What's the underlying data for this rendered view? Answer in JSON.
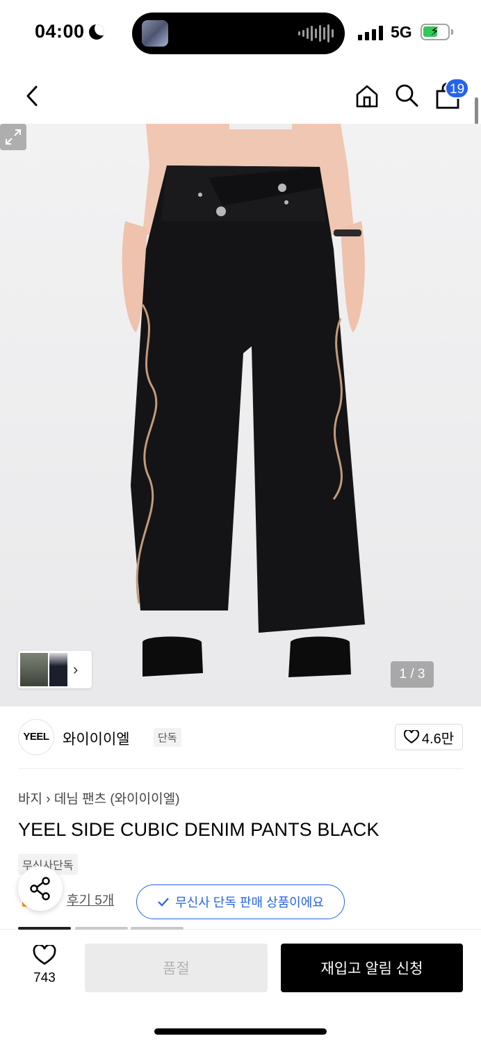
{
  "status_bar": {
    "time": "04:00",
    "network": "5G"
  },
  "nav": {
    "cart_count": "19"
  },
  "gallery": {
    "counter": "1 / 3"
  },
  "brand": {
    "logo_text": "YEEL",
    "name": "와이이이엘",
    "tag": "단독",
    "likes": "4.6만"
  },
  "product": {
    "breadcrumb_parts": [
      "바지",
      "데님 팬츠 (와이이이엘)"
    ],
    "title": "YEEL SIDE CUBIC DENIM PANTS BLACK",
    "exclusive_tag": "무신사단독",
    "review_text": "후기 5개",
    "exclusive_pill": "무신사 단독 판매 상품이에요"
  },
  "bottom_bar": {
    "wish_count": "743",
    "soldout_label": "품절",
    "notify_label": "재입고 알림 신청"
  },
  "colors": {
    "accent_blue": "#2563eb",
    "primary_black": "#000000",
    "disabled_gray": "#ebebeb"
  }
}
